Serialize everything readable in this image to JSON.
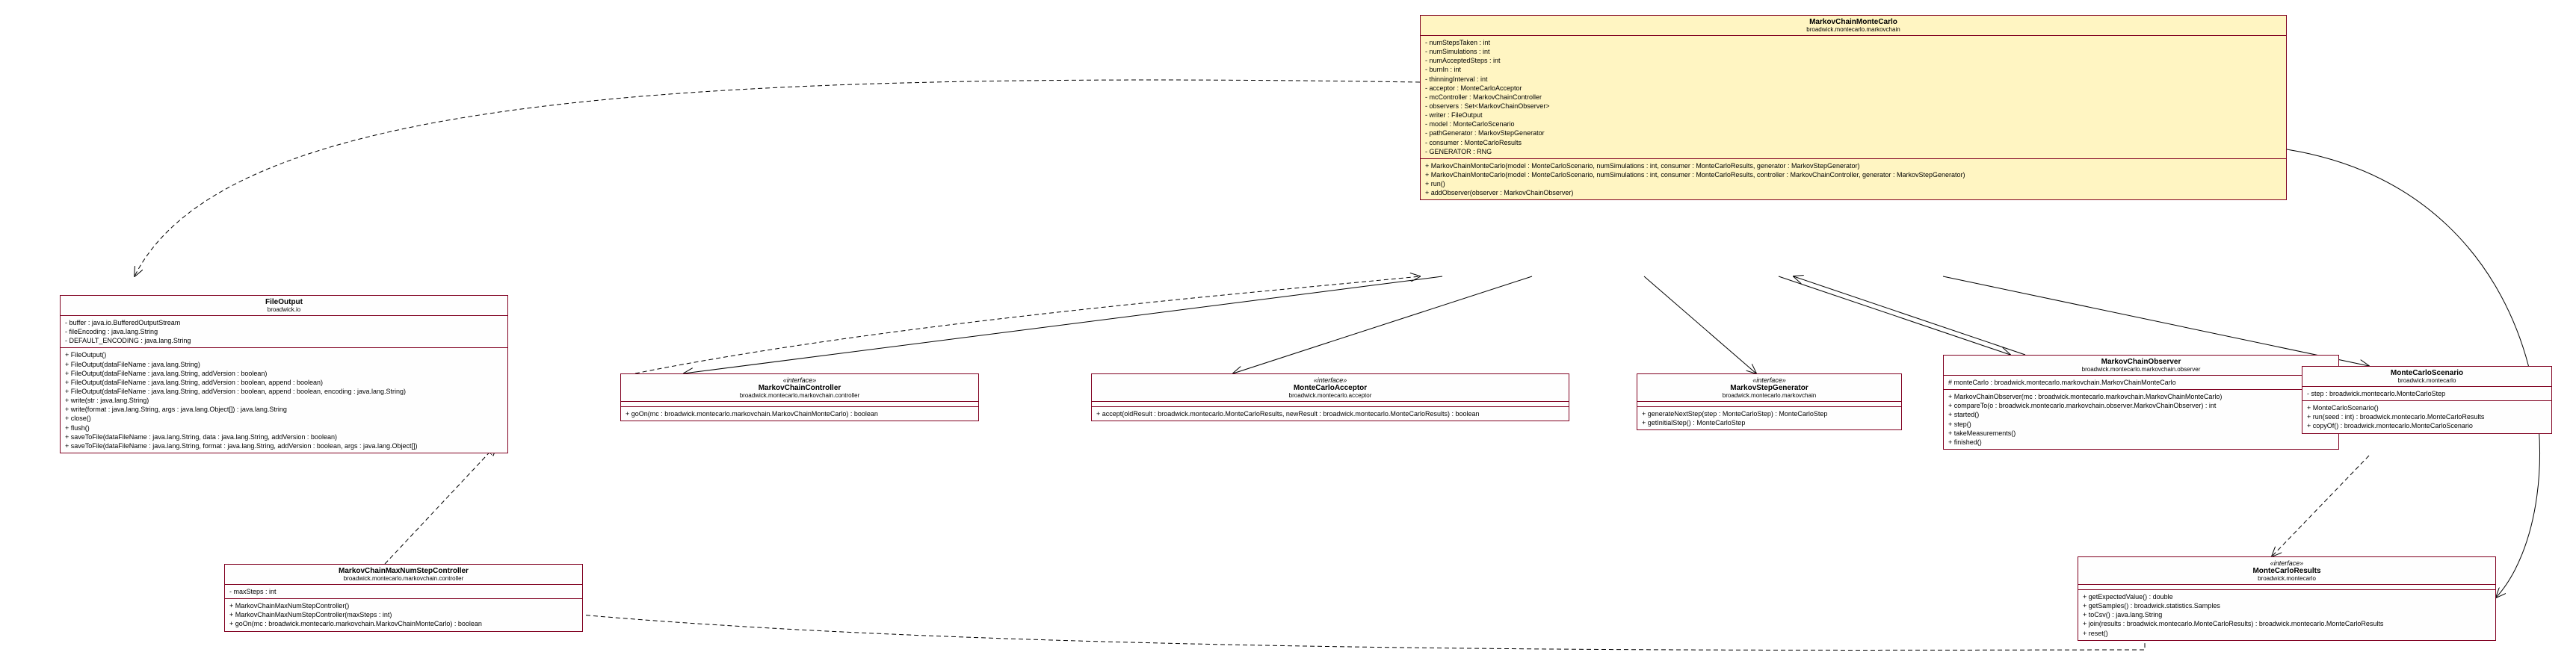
{
  "classes": {
    "mcmc": {
      "name": "MarkovChainMonteCarlo",
      "package": "broadwick.montecarlo.markovchain",
      "fields": [
        "- numStepsTaken : int",
        "- numSimulations : int",
        "- numAcceptedSteps : int",
        "- burnIn : int",
        "- thinningInterval : int",
        "- acceptor : MonteCarloAcceptor",
        "- mcController : MarkovChainController",
        "- observers : Set<MarkovChainObserver>",
        "- writer : FileOutput",
        "- model : MonteCarloScenario",
        "- pathGenerator : MarkovStepGenerator",
        "- consumer : MonteCarloResults",
        "- GENERATOR : RNG"
      ],
      "methods": [
        "+ MarkovChainMonteCarlo(model : MonteCarloScenario, numSimulations : int, consumer : MonteCarloResults, generator : MarkovStepGenerator)",
        "+ MarkovChainMonteCarlo(model : MonteCarloScenario, numSimulations : int, consumer : MonteCarloResults, controller : MarkovChainController, generator : MarkovStepGenerator)",
        "+ run()",
        "+ addObserver(observer : MarkovChainObserver)"
      ]
    },
    "fileoutput": {
      "name": "FileOutput",
      "package": "broadwick.io",
      "fields": [
        "- buffer : java.io.BufferedOutputStream",
        "- fileEncoding : java.lang.String",
        "- DEFAULT_ENCODING : java.lang.String"
      ],
      "methods": [
        "+ FileOutput()",
        "+ FileOutput(dataFileName : java.lang.String)",
        "+ FileOutput(dataFileName : java.lang.String, addVersion : boolean)",
        "+ FileOutput(dataFileName : java.lang.String, addVersion : boolean, append : boolean)",
        "+ FileOutput(dataFileName : java.lang.String, addVersion : boolean, append : boolean, encoding : java.lang.String)",
        "+ write(str : java.lang.String)",
        "+ write(format : java.lang.String, args : java.lang.Object[]) : java.lang.String",
        "+ close()",
        "+ flush()",
        "+ saveToFile(dataFileName : java.lang.String, data : java.lang.String, addVersion : boolean)",
        "+ saveToFile(dataFileName : java.lang.String, format : java.lang.String, addVersion : boolean, args : java.lang.Object[])"
      ]
    },
    "controller": {
      "stereotype": "«interface»",
      "name": "MarkovChainController",
      "package": "broadwick.montecarlo.markovchain.controller",
      "methods": [
        "+ goOn(mc : broadwick.montecarlo.markovchain.MarkovChainMonteCarlo) : boolean"
      ]
    },
    "acceptor": {
      "stereotype": "«interface»",
      "name": "MonteCarloAcceptor",
      "package": "broadwick.montecarlo.acceptor",
      "methods": [
        "+ accept(oldResult : broadwick.montecarlo.MonteCarloResults, newResult : broadwick.montecarlo.MonteCarloResults) : boolean"
      ]
    },
    "stepgen": {
      "stereotype": "«interface»",
      "name": "MarkovStepGenerator",
      "package": "broadwick.montecarlo.markovchain",
      "methods": [
        "+ generateNextStep(step : MonteCarloStep) : MonteCarloStep",
        "+ getInitialStep() : MonteCarloStep"
      ]
    },
    "observer": {
      "name": "MarkovChainObserver",
      "package": "broadwick.montecarlo.markovchain.observer",
      "fields": [
        "# monteCarlo : broadwick.montecarlo.markovchain.MarkovChainMonteCarlo"
      ],
      "methods": [
        "+ MarkovChainObserver(mc : broadwick.montecarlo.markovchain.MarkovChainMonteCarlo)",
        "+ compareTo(o : broadwick.montecarlo.markovchain.observer.MarkovChainObserver) : int",
        "+ started()",
        "+ step()",
        "+ takeMeasurements()",
        "+ finished()"
      ]
    },
    "scenario": {
      "name": "MonteCarloScenario",
      "package": "broadwick.montecarlo",
      "fields": [
        "- step : broadwick.montecarlo.MonteCarloStep"
      ],
      "methods": [
        "+ MonteCarloScenario()",
        "+ run(seed : int) : broadwick.montecarlo.MonteCarloResults",
        "+ copyOf() : broadwick.montecarlo.MonteCarloScenario"
      ]
    },
    "maxnum": {
      "name": "MarkovChainMaxNumStepController",
      "package": "broadwick.montecarlo.markovchain.controller",
      "fields": [
        "- maxSteps : int"
      ],
      "methods": [
        "+ MarkovChainMaxNumStepController()",
        "+ MarkovChainMaxNumStepController(maxSteps : int)",
        "+ goOn(mc : broadwick.montecarlo.markovchain.MarkovChainMonteCarlo) : boolean"
      ]
    },
    "results": {
      "stereotype": "«interface»",
      "name": "MonteCarloResults",
      "package": "broadwick.montecarlo",
      "methods": [
        "+ getExpectedValue() : double",
        "+ getSamples() : broadwick.statistics.Samples",
        "+ toCsv() : java.lang.String",
        "+ join(results : broadwick.montecarlo.MonteCarloResults) : broadwick.montecarlo.MonteCarloResults",
        "+ reset()"
      ]
    }
  }
}
